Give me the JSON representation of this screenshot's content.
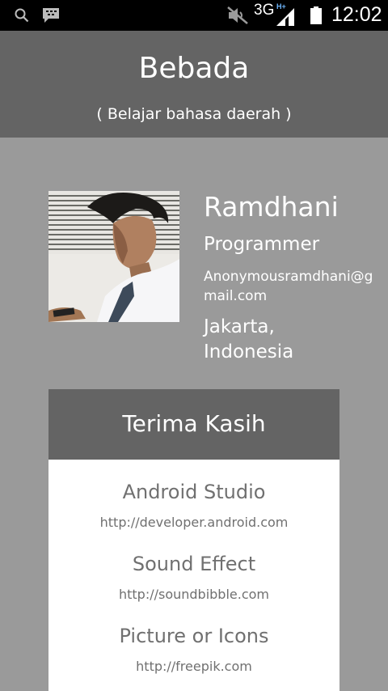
{
  "status_bar": {
    "icons": [
      "search-icon",
      "bbm-icon",
      "mute-icon",
      "signal-icon",
      "battery-icon"
    ],
    "network": "3G",
    "network_badge": "H+",
    "time": "12:02"
  },
  "header": {
    "title": "Bebada",
    "subtitle": "( Belajar bahasa daerah )",
    "background": "#646464"
  },
  "profile": {
    "name": "Ramdhani",
    "role": "Programmer",
    "email": "Anonymousramdhani@gmail.com",
    "location": "Jakarta, Indonesia"
  },
  "credits": {
    "title": "Terima Kasih",
    "items": [
      {
        "name": "Android Studio",
        "url": "http://developer.android.com"
      },
      {
        "name": "Sound Effect",
        "url": "http://soundbibble.com"
      },
      {
        "name": "Picture or Icons",
        "url": "http://freepik.com"
      }
    ]
  },
  "colors": {
    "page_background": "#9a9a9a",
    "header_background": "#646464",
    "card_background": "#ffffff",
    "credit_text": "#707070"
  }
}
